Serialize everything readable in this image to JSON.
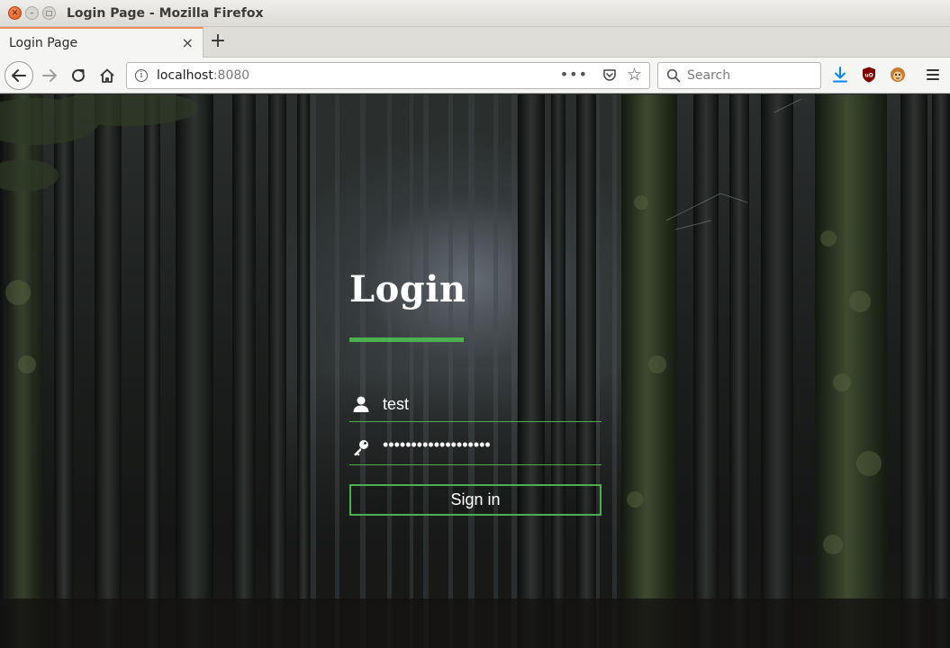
{
  "window": {
    "title": "Login Page - Mozilla Firefox"
  },
  "tab": {
    "label": "Login Page",
    "close_glyph": "×",
    "new_tab_glyph": "+"
  },
  "nav": {
    "url_host": "localhost",
    "url_port": ":8080",
    "page_actions_glyph": "•••",
    "search_placeholder": "Search"
  },
  "page": {
    "heading": "Login",
    "username_value": "test",
    "password_mask": "•••••••••••••••••••",
    "sign_in_label": "Sign in"
  },
  "colors": {
    "accent": "#4caf50",
    "tab_highlight": "#f08c5a",
    "download_icon": "#0a84ff",
    "ublock_icon": "#800000"
  },
  "icons": [
    "back-arrow-icon",
    "forward-arrow-icon",
    "reload-icon",
    "home-icon",
    "info-icon",
    "pocket-icon",
    "star-icon",
    "search-icon",
    "download-icon",
    "ublock-icon",
    "tampermonkey-icon",
    "hamburger-menu-icon",
    "user-icon",
    "key-icon"
  ]
}
